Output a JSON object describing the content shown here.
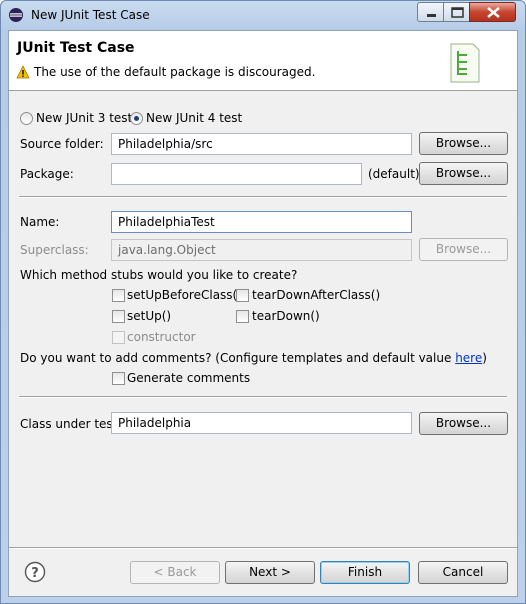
{
  "window": {
    "title": "New JUnit Test Case"
  },
  "header": {
    "title": "JUnit Test Case",
    "message": "The use of the default package is discouraged.",
    "icon": "junit-wizard-banner"
  },
  "version_options": [
    {
      "label": "New JUnit 3 test",
      "selected": false
    },
    {
      "label": "New JUnit 4 test",
      "selected": true
    }
  ],
  "form": {
    "source_folder": {
      "label": "Source folder:",
      "value": "Philadelphia/src",
      "button": "Browse..."
    },
    "package": {
      "label": "Package:",
      "value": "",
      "suffix": "(default)",
      "button": "Browse..."
    },
    "name": {
      "label": "Name:",
      "value": "PhiladelphiaTest"
    },
    "superclass": {
      "label": "Superclass:",
      "value": "java.lang.Object",
      "button": "Browse..."
    },
    "stubs_question": "Which method stubs would you like to create?",
    "stubs": [
      {
        "label": "setUpBeforeClass()",
        "checked": false,
        "enabled": true
      },
      {
        "label": "tearDownAfterClass()",
        "checked": false,
        "enabled": true
      },
      {
        "label": "setUp()",
        "checked": false,
        "enabled": true
      },
      {
        "label": "tearDown()",
        "checked": false,
        "enabled": true
      },
      {
        "label": "constructor",
        "checked": false,
        "enabled": false
      }
    ],
    "comments_question_prefix": "Do you want to add comments? (Configure templates and default value ",
    "comments_link": "here",
    "comments_question_suffix": ")",
    "generate_comments": {
      "label": "Generate comments",
      "checked": false
    },
    "class_under_test": {
      "label": "Class under test:",
      "value": "Philadelphia",
      "button": "Browse..."
    }
  },
  "footer": {
    "back": "< Back",
    "next": "Next >",
    "finish": "Finish",
    "cancel": "Cancel"
  }
}
